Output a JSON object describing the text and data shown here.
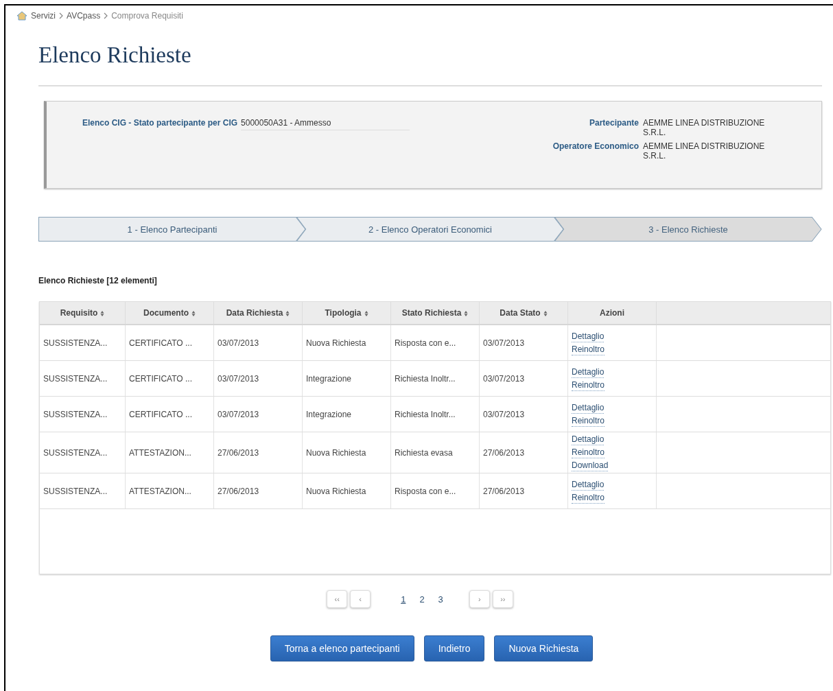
{
  "breadcrumb": [
    "Servizi",
    "AVCpass",
    "Comprova Requisiti"
  ],
  "title": "Elenco Richieste",
  "info": {
    "cig_label": "Elenco CIG - Stato partecipante per CIG",
    "cig_value": "5000050A31 - Ammesso",
    "fields": [
      {
        "label": "Partecipante",
        "value": "AEMME LINEA DISTRIBUZIONE S.R.L."
      },
      {
        "label": "Operatore Economico",
        "value": "AEMME LINEA DISTRIBUZIONE S.R.L."
      }
    ]
  },
  "steps": [
    {
      "label": "1 - Elenco Partecipanti",
      "selected": false
    },
    {
      "label": "2 - Elenco Operatori Economici",
      "selected": false
    },
    {
      "label": "3 - Elenco Richieste",
      "selected": true
    }
  ],
  "list_heading": "Elenco Richieste [12 elementi]",
  "table": {
    "columns": [
      {
        "label": "Requisito",
        "sortable": true
      },
      {
        "label": "Documento",
        "sortable": true
      },
      {
        "label": "Data Richiesta",
        "sortable": true
      },
      {
        "label": "Tipologia",
        "sortable": true
      },
      {
        "label": "Stato Richiesta",
        "sortable": true
      },
      {
        "label": "Data Stato",
        "sortable": true
      },
      {
        "label": "Azioni",
        "sortable": false
      }
    ],
    "rows": [
      {
        "cells": [
          "SUSSISTENZA...",
          "CERTIFICATO ...",
          "03/07/2013",
          "Nuova Richiesta",
          "Risposta con e...",
          "03/07/2013"
        ],
        "actions": [
          "Dettaglio",
          "Reinoltro"
        ]
      },
      {
        "cells": [
          "SUSSISTENZA...",
          "CERTIFICATO ...",
          "03/07/2013",
          "Integrazione",
          "Richiesta Inoltr...",
          "03/07/2013"
        ],
        "actions": [
          "Dettaglio",
          "Reinoltro"
        ]
      },
      {
        "cells": [
          "SUSSISTENZA...",
          "CERTIFICATO ...",
          "03/07/2013",
          "Integrazione",
          "Richiesta Inoltr...",
          "03/07/2013"
        ],
        "actions": [
          "Dettaglio",
          "Reinoltro"
        ]
      },
      {
        "cells": [
          "SUSSISTENZA...",
          "ATTESTAZION...",
          "27/06/2013",
          "Nuova Richiesta",
          "Richiesta evasa",
          "27/06/2013"
        ],
        "actions": [
          "Dettaglio",
          "Reinoltro",
          "Download"
        ]
      },
      {
        "cells": [
          "SUSSISTENZA...",
          "ATTESTAZION...",
          "27/06/2013",
          "Nuova Richiesta",
          "Risposta con e...",
          "27/06/2013"
        ],
        "actions": [
          "Dettaglio",
          "Reinoltro"
        ]
      }
    ]
  },
  "pager": {
    "first": "‹‹",
    "prev": "‹",
    "pages": [
      {
        "label": "1",
        "selected": true
      },
      {
        "label": "2",
        "selected": false
      },
      {
        "label": "3",
        "selected": false
      }
    ],
    "next": "›",
    "last": "››"
  },
  "buttons": [
    "Torna a elenco partecipanti",
    "Indietro",
    "Nuova Richiesta"
  ]
}
